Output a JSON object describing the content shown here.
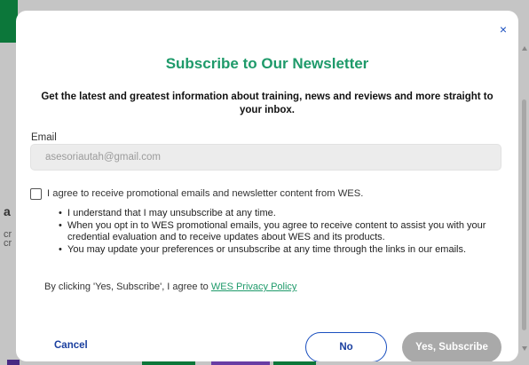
{
  "background": {
    "partial_text_1": "a",
    "partial_text_2": "cr",
    "partial_text_3": "cr",
    "partial_text_4": "g"
  },
  "modal": {
    "title": "Subscribe to Our Newsletter",
    "subtitle": "Get the latest and greatest information about training, news and reviews and more straight to your inbox.",
    "close_icon": "×",
    "email": {
      "label": "Email",
      "value": "asesoriautah@gmail.com",
      "placeholder": ""
    },
    "consent": {
      "checked": false,
      "label": "I agree to receive promotional emails and newsletter content from WES."
    },
    "bullets": [
      "I understand that I may unsubscribe at any time.",
      "When you opt in to WES promotional emails, you agree to receive content to assist you with your credential evaluation and to receive updates about WES and its products.",
      "You may update your preferences or unsubscribe at any time through the links in our emails."
    ],
    "privacy_prefix": "By clicking 'Yes, Subscribe', I agree to ",
    "privacy_link": "WES Privacy Policy",
    "buttons": {
      "cancel": "Cancel",
      "no": "No",
      "yes": "Yes, Subscribe"
    }
  },
  "colors": {
    "title": "#1e9a6a",
    "link": "#1e9a6a",
    "button_text": "#1a3f9f",
    "disabled_button": "#a9a9a9"
  }
}
